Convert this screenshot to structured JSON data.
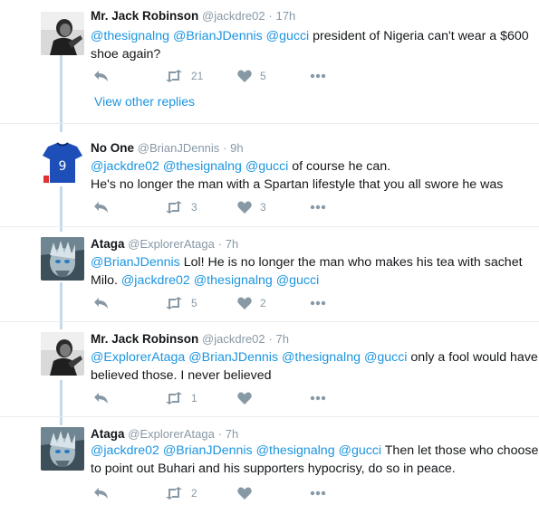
{
  "colors": {
    "accent": "#1b95e0",
    "muted": "#8899a6",
    "text": "#14171a",
    "thread": "#c5d9e8"
  },
  "icons": {
    "reply": "reply-icon",
    "retweet": "retweet-icon",
    "like": "heart-icon",
    "more": "more-dots-icon"
  },
  "view_other_replies": "View other replies",
  "tweets": [
    {
      "name": "Mr. Jack Robinson",
      "handle": "@jackdre02",
      "dot": "·",
      "time": "17h",
      "line1": {
        "m1": "@thesignalng",
        "m2": "@BrianJDennis",
        "m3": "@gucci",
        "t1": " president of Nigeria can't wear a $600"
      },
      "line2": {
        "t1": "shoe again?"
      },
      "retweets": "21",
      "likes": "5"
    },
    {
      "name": "No One",
      "handle": "@BrianJDennis",
      "dot": "·",
      "time": "9h",
      "line1": {
        "m1": "@jackdre02",
        "m2": "@thesignalng",
        "m3": "@gucci",
        "t1": " of course he can."
      },
      "line2": {
        "t1": "He's no longer the man with a Spartan lifestyle that you all swore he was"
      },
      "retweets": "3",
      "likes": "3",
      "avatar_jersey_number": "9"
    },
    {
      "name": "Ataga",
      "handle": "@ExplorerAtaga",
      "dot": "·",
      "time": "7h",
      "line1": {
        "m1": "@BrianJDennis",
        "t1": " Lol! He is no longer the man who makes his tea with sachet"
      },
      "line2": {
        "t1": "Milo. ",
        "m1": "@jackdre02",
        "m2": "@thesignalng",
        "m3": "@gucci"
      },
      "retweets": "5",
      "likes": "2"
    },
    {
      "name": "Mr. Jack Robinson",
      "handle": "@jackdre02",
      "dot": "·",
      "time": "7h",
      "line1": {
        "m1": "@ExplorerAtaga",
        "m2": "@BrianJDennis",
        "m3": "@thesignalng",
        "m4": "@gucci",
        "t1": " only a fool would have"
      },
      "line2": {
        "t1": "believed those. I never believed"
      },
      "retweets": "1",
      "likes": ""
    },
    {
      "name": "Ataga",
      "handle": "@ExplorerAtaga",
      "dot": "·",
      "time": "7h",
      "line1": {
        "m1": "@jackdre02",
        "m2": "@BrianJDennis",
        "m3": "@thesignalng",
        "m4": "@gucci",
        "t1": " Then let those who choose"
      },
      "line2": {
        "t1": "to point out Buhari and his supporters hypocrisy, do so in peace."
      },
      "retweets": "2",
      "likes": ""
    }
  ]
}
